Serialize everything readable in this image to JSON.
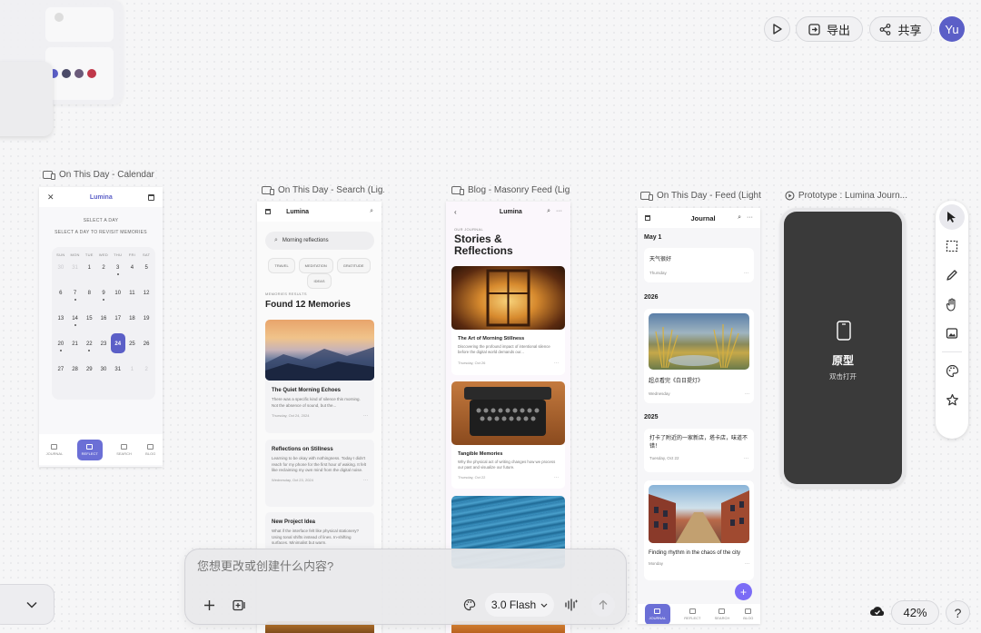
{
  "toolbar": {
    "export_label": "导出",
    "share_label": "共享",
    "avatar_text": "Yu",
    "zoom": "42%"
  },
  "prompt": {
    "placeholder": "您想更改或创建什么内容?",
    "model": "3.0 Flash"
  },
  "frames": {
    "calendar": {
      "label": "On This Day - Calendar",
      "logo": "Lumina",
      "select_title": "SELECT A DAY",
      "select_sub": "SELECT A DAY TO REVISIT MEMORIES",
      "weekdays": [
        "SUN",
        "MON",
        "TUE",
        "WED",
        "THU",
        "FRI",
        "SAT"
      ],
      "rows": [
        [
          "30",
          "31",
          "1",
          "2",
          "3",
          "4",
          "5"
        ],
        [
          "6",
          "7",
          "8",
          "9",
          "10",
          "11",
          "12"
        ],
        [
          "13",
          "14",
          "15",
          "16",
          "17",
          "18",
          "19"
        ],
        [
          "20",
          "21",
          "22",
          "23",
          "24",
          "25",
          "26"
        ],
        [
          "27",
          "28",
          "29",
          "30",
          "31",
          "1",
          "2"
        ]
      ],
      "selected_day": "24",
      "nav": [
        "JOURNAL",
        "REFLECT",
        "SEARCH",
        "BLOG"
      ]
    },
    "search": {
      "label": "On This Day - Search (Lig...",
      "logo": "Lumina",
      "query": "Morning reflections",
      "chips": [
        "TRAVEL",
        "MEDITATION",
        "GRATITUDE",
        "IDEAS"
      ],
      "results_label": "MEMORIES RESULTS",
      "results_title": "Found 12 Memories",
      "cards": [
        {
          "title": "The Quiet Morning Echoes",
          "body": "There was a specific kind of silence this morning. Not the absence of sound, but the...",
          "date": "Thursday, Oct 24, 2024"
        },
        {
          "title": "Reflections on Stillness",
          "body": "Learning to be okay with nothingness. Today I didn't reach for my phone for the first hour of waking. It felt like reclaiming my own mind from the digital noise.",
          "date": "Wednesday, Oct 23, 2024"
        },
        {
          "title": "New Project Idea",
          "body": "What if the interface felt like physical stationery? Using tonal shifts instead of lines. In-shifting surfaces. Minimalist but warm.",
          "date": ""
        }
      ]
    },
    "masonry": {
      "label": "Blog - Masonry Feed (Lig...",
      "logo": "Lumina",
      "kicker": "OUR JOURNAL",
      "title_line1": "Stories &",
      "title_line2": "Reflections",
      "posts": [
        {
          "title": "The Art of Morning Stillness",
          "body": "Discovering the profound impact of intentional silence before the digital world demands our...",
          "date": "Thursday, Oct 26"
        },
        {
          "title": "Tangible Memories",
          "body": "Why the physical act of writing changes how we process our past and visualize our future.",
          "date": "Thursday, Oct 22"
        }
      ]
    },
    "feed": {
      "label": "On This Day - Feed (Light...",
      "title": "Journal",
      "sections": [
        {
          "heading": "May 1",
          "entries": [
            {
              "text": "天气很好",
              "date": "Thursday"
            }
          ]
        },
        {
          "heading": "2026",
          "entries": [
            {
              "text": "超点看完《白日提灯》",
              "date": "Wednesday"
            }
          ]
        },
        {
          "heading": "2025",
          "entries": [
            {
              "text": "打卡了附近的一家新店，塔卡店，味道不错！",
              "date": "Tuesday, Oct 22"
            },
            {
              "text": "Finding rhythm in the chaos of the city",
              "date": "Monday"
            }
          ]
        }
      ],
      "nav": [
        "JOURNAL",
        "REFLECT",
        "SEARCH",
        "BLOG"
      ]
    },
    "prototype": {
      "label": "Prototype : Lumina Journ...",
      "title": "原型",
      "subtitle": "双击打开"
    }
  },
  "colors": {
    "accent": "#6b6fd6",
    "avatar": "#5b5fc7",
    "fab": "#7b6cf6",
    "prototype_bg": "#3a3a3a"
  }
}
